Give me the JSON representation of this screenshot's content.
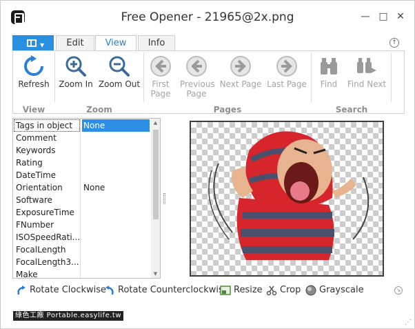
{
  "window": {
    "title": "Free Opener - 21965@2x.png",
    "minimize_glyph": "—",
    "maximize_glyph": "□",
    "close_glyph": "✕"
  },
  "tabs": [
    {
      "label": ""
    },
    {
      "label": "Edit"
    },
    {
      "label": "View"
    },
    {
      "label": "Info"
    }
  ],
  "collapse_glyph": "↑",
  "ribbon": {
    "buttons": {
      "refresh": "Refresh",
      "zoom_in": "Zoom In",
      "zoom_out": "Zoom Out",
      "first_page": "First Page",
      "previous_page": "Previous Page",
      "next_page": "Next Page",
      "last_page": "Last Page",
      "find": "Find",
      "find_next": "Find Next"
    },
    "groups": {
      "view": "View",
      "zoom": "Zoom",
      "pages": "Pages",
      "search": "Search"
    }
  },
  "properties": [
    {
      "key": "Tags in object",
      "value": "None"
    },
    {
      "key": "Comment",
      "value": ""
    },
    {
      "key": "Keywords",
      "value": ""
    },
    {
      "key": "Rating",
      "value": ""
    },
    {
      "key": "DateTime",
      "value": ""
    },
    {
      "key": "Orientation",
      "value": "None"
    },
    {
      "key": "Software",
      "value": ""
    },
    {
      "key": "ExposureTime",
      "value": ""
    },
    {
      "key": "FNumber",
      "value": ""
    },
    {
      "key": "ISOSpeedRati...",
      "value": ""
    },
    {
      "key": "FocalLength",
      "value": ""
    },
    {
      "key": "FocalLength3...",
      "value": ""
    },
    {
      "key": "Make",
      "value": ""
    }
  ],
  "bottom_toolbar": {
    "rotate_cw": "Rotate Clockwise",
    "rotate_ccw": "Rotate Counterclockwise",
    "resize": "Resize",
    "crop": "Crop",
    "grayscale": "Grayscale"
  },
  "footer": {
    "watermark": "綠色工廠 Portable.easylife.tw"
  },
  "colors": {
    "accent": "#2b8fe0",
    "selection": "#2d8ee6",
    "disabled_text": "#a4a4a4"
  }
}
